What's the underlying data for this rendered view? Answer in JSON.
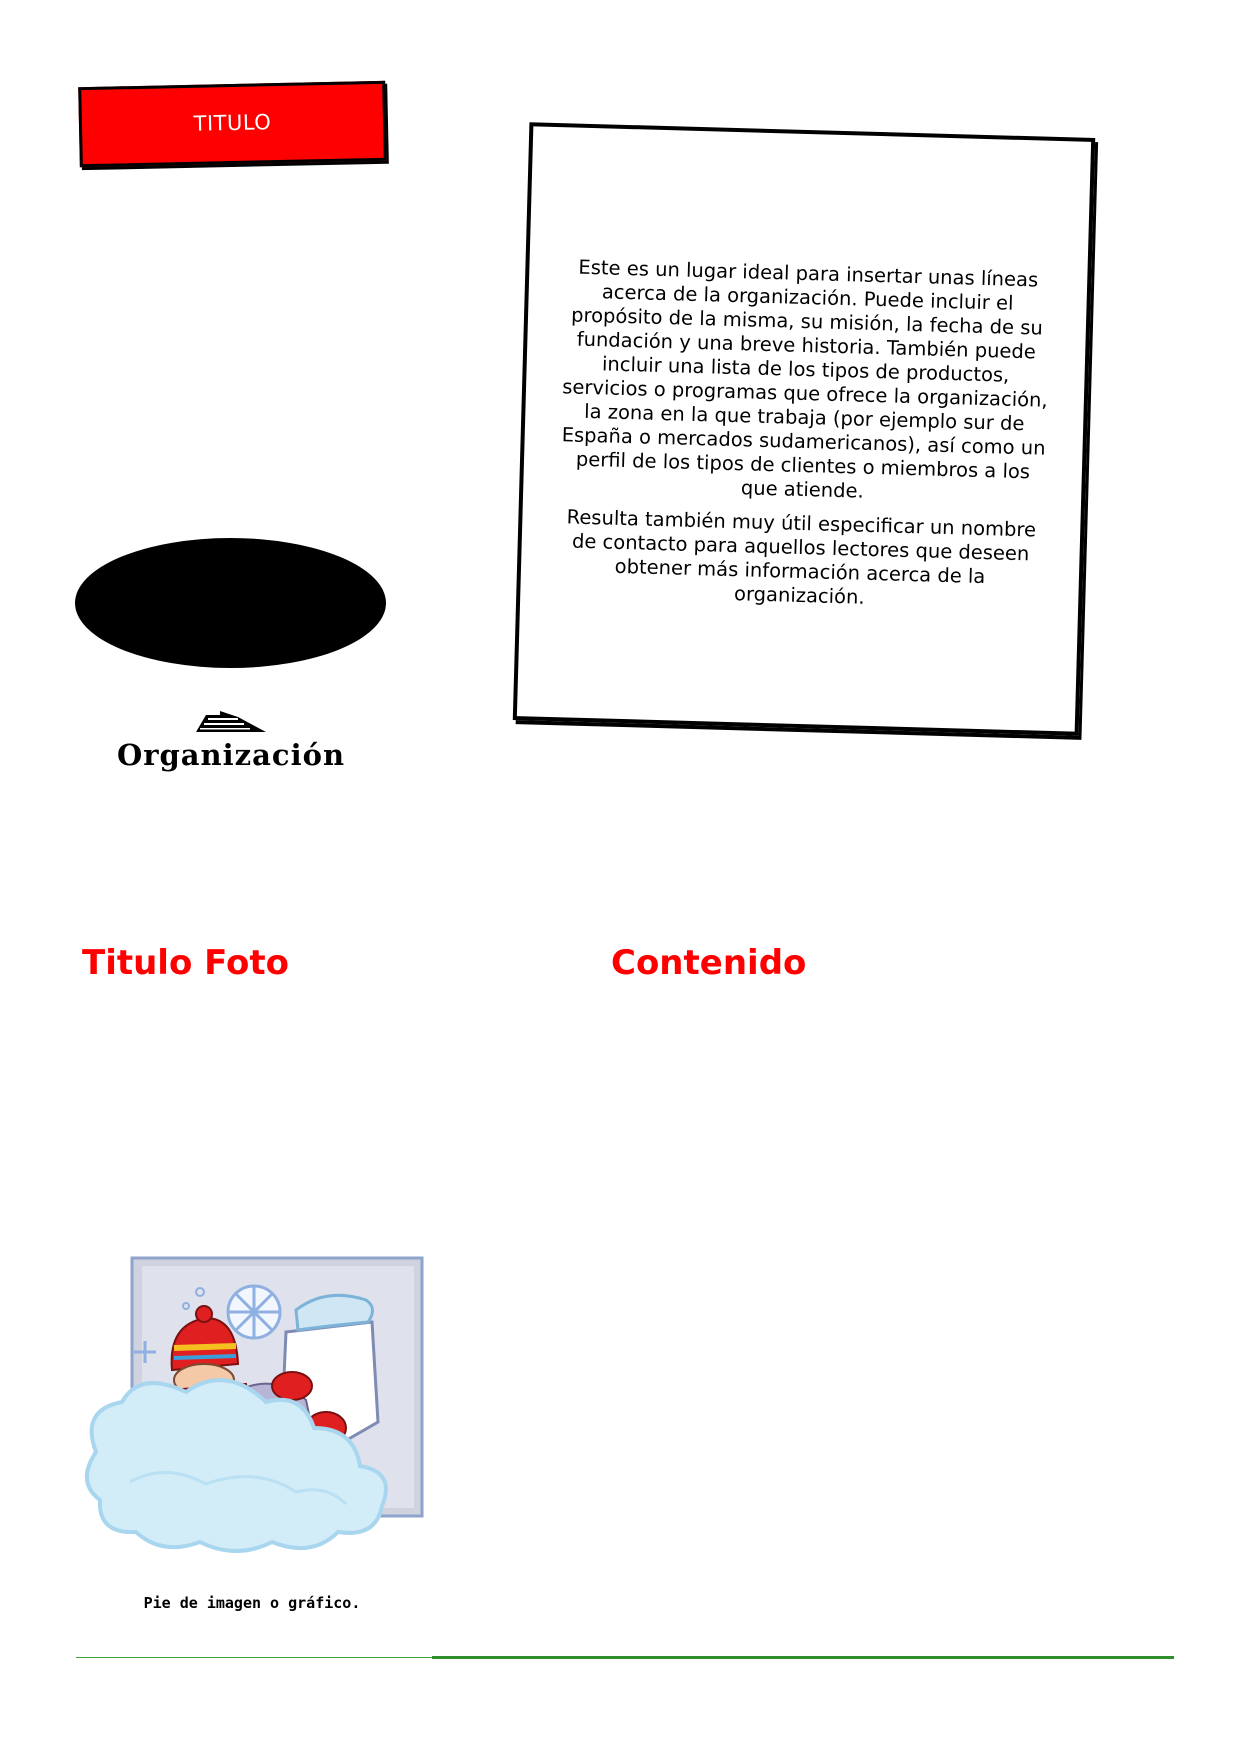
{
  "header": {
    "title_label": "TITULO"
  },
  "about": {
    "paragraphs": [
      "Este es un lugar ideal para insertar unas líneas acerca de la organización. Puede incluir el propósito de la misma, su misión, la fecha de su fundación y una breve historia. También puede incluir una lista de los tipos de productos, servicios o programas que ofrece la organización, la zona en la que trabaja (por ejemplo sur de España o mercados sudamericanos), así como un perfil de los tipos de clientes o miembros a los que atiende.",
      "Resulta también muy útil especificar un nombre de contacto para aquellos lectores que deseen obtener más información acerca de la organización."
    ]
  },
  "logo": {
    "organization_name": "Organización",
    "mark_icon": "stepped-triangle-icon"
  },
  "sections": {
    "photo_heading": "Titulo Foto",
    "content_heading": "Contenido"
  },
  "photo": {
    "icon": "winter-child-in-snow-clipart",
    "caption": "Pie de imagen o gráfico."
  },
  "colors": {
    "accent_red": "#ff0000",
    "rule_green": "#2f8f2f"
  }
}
